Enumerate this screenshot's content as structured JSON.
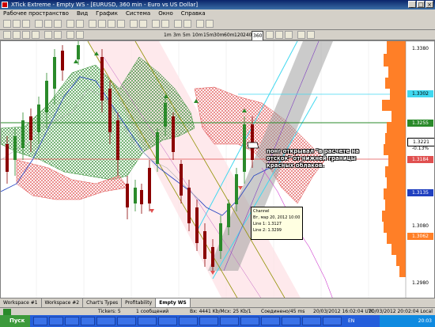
{
  "window": {
    "title": "XTick Extreme - Empty WS - [EURUSD, 360 min - Euro vs US Dollar]",
    "controls": [
      "_",
      "□",
      "×"
    ]
  },
  "menu": [
    "Рабочее пространство",
    "Вид",
    "График",
    "Система",
    "Окно",
    "Справка"
  ],
  "timeframes": [
    "1m",
    "3m",
    "5m",
    "10m",
    "15m",
    "30m",
    "60m",
    "120",
    "240",
    "360"
  ],
  "price_axis": {
    "ticks": [
      "1.3380",
      "1.3302",
      "1.3255",
      "1.3221",
      "-0.13%",
      "1.3184",
      "1.3135",
      "1.3080",
      "1.3062",
      "1.2980"
    ]
  },
  "annotation": "понг открывал \"в расчете на отскок\" от нижней границы красных облаков.",
  "tooltip": {
    "title": "Channel",
    "date": "Вт, мар 20, 2012 10:00",
    "line1": "Line 1: 1.3127",
    "line2": "Line 2: 1.3299"
  },
  "bottom_tabs": [
    "Workspace #1",
    "Workspace #2",
    "Chart's Types",
    "Profitability",
    "Empty WS"
  ],
  "status": {
    "tickers": "Tickers: 5",
    "messages": "1 сообщений",
    "traffic": "Bx: 4441 Kb/Mcx: 25 Kb/1",
    "connection": "Соединено/45 ms",
    "time_local": "20/03/2012 16:02:04 UTC",
    "time_server": "20/03/2012 20:02:04 Local"
  },
  "taskbar": {
    "start": "Пуск",
    "lang": "EN",
    "clock": "20:03"
  },
  "colors": {
    "cloud_red": "#e05050",
    "cloud_green": "#2a8a2a",
    "bull_candle": "#2a8a2a",
    "bear_candle": "#8b0000",
    "channel_band": "#a0a0a0",
    "channel_cyan": "#40d8f0",
    "volume_profile": "#ff7f27"
  }
}
